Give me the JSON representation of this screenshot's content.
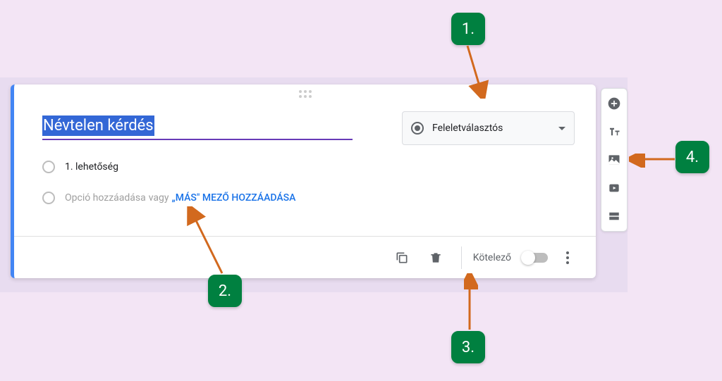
{
  "question": {
    "title": "Névtelen kérdés",
    "type_label": "Feleletválasztós",
    "option1": "1. lehetőség",
    "add_option": "Opció hozzáadása",
    "or_text": " vagy ",
    "other_link": "„MÁS\" MEZŐ HOZZÁADÁSA",
    "required_label": "Kötelező"
  },
  "callouts": {
    "c1": "1.",
    "c2": "2.",
    "c3": "3.",
    "c4": "4."
  }
}
